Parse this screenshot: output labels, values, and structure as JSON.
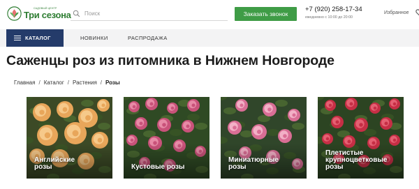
{
  "header": {
    "logo": {
      "sub": "САДОВЫЙ ЦЕНТР",
      "name": "Три сезона",
      "icon": "leaf-logo-icon"
    },
    "search": {
      "placeholder": "Поиск",
      "value": ""
    },
    "call_button": "Заказать звонок",
    "phone": "+7 (920) 258-17-34",
    "hours": "ежедневно с 10:00 до 20:00",
    "favorites": "Избранное"
  },
  "nav": {
    "catalog": "КАТАЛОГ",
    "items": [
      {
        "label": "НОВИНКИ"
      },
      {
        "label": "РАСПРОДАЖА"
      }
    ]
  },
  "page": {
    "title": "Саженцы роз из питомника в Нижнем Новгороде"
  },
  "breadcrumb": [
    {
      "label": "Главная"
    },
    {
      "label": "Каталог"
    },
    {
      "label": "Растения"
    },
    {
      "label": "Розы"
    }
  ],
  "categories": [
    {
      "line1": "Английские",
      "line2": "розы",
      "colors": {
        "bg": "#3c4a26",
        "flower": "#e8a65a",
        "flower_light": "#f6c98a"
      }
    },
    {
      "line1": "Кустовые розы",
      "line2": "",
      "colors": {
        "bg": "#2f4a24",
        "flower": "#c9527a",
        "flower_light": "#e78aa6"
      }
    },
    {
      "line1": "Миниатюрные",
      "line2": "розы",
      "colors": {
        "bg": "#30462a",
        "flower": "#d96e95",
        "flower_light": "#f2b0c6"
      }
    },
    {
      "line1": "Плетистые",
      "line2": "крупноцветковые",
      "line3": "розы",
      "colors": {
        "bg": "#2c4422",
        "flower": "#c62e45",
        "flower_light": "#e46072"
      }
    }
  ],
  "colors": {
    "accent_green": "#3f9c46",
    "nav_blue": "#243b6a",
    "nav_bg": "#f3f3f4"
  }
}
